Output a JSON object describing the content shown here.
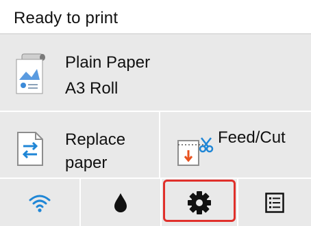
{
  "status": {
    "text": "Ready to print"
  },
  "paper": {
    "type": "Plain Paper",
    "size": "A3 Roll",
    "icon": "roll-paper-icon"
  },
  "actions": {
    "replace_label": "Replace paper",
    "replace_icon": "replace-paper-icon",
    "feed_label": "Feed/Cut",
    "feed_icon": "feed-cut-icon"
  },
  "tabs": [
    {
      "icon": "wifi-icon",
      "selected": false
    },
    {
      "icon": "ink-drop-icon",
      "selected": false
    },
    {
      "icon": "gear-icon",
      "selected": true
    },
    {
      "icon": "list-menu-icon",
      "selected": false
    }
  ],
  "colors": {
    "panel_bg": "#e9e9e9",
    "text": "#111111",
    "selection_border": "#e0302b",
    "accent_blue": "#1f86d6",
    "accent_orange": "#e8521f"
  }
}
